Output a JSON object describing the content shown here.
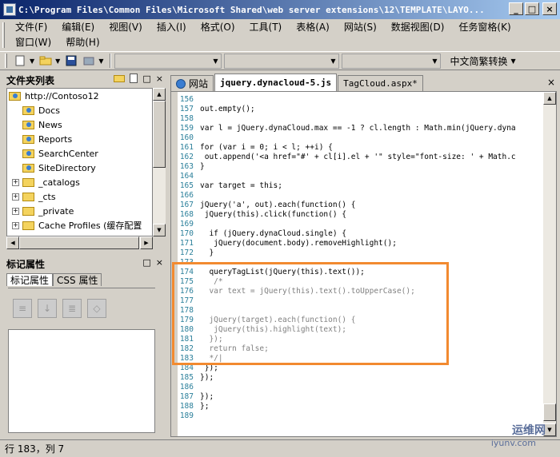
{
  "window": {
    "title": "C:\\Program Files\\Common Files\\Microsoft Shared\\web server extensions\\12\\TEMPLATE\\LAYO..."
  },
  "menu": {
    "row1": [
      "文件(F)",
      "编辑(E)",
      "视图(V)",
      "插入(I)",
      "格式(O)",
      "工具(T)",
      "表格(A)",
      "网站(S)",
      "数据视图(D)",
      "任务窗格(K)"
    ],
    "row2": [
      "窗口(W)",
      "帮助(H)"
    ]
  },
  "toolbar": {
    "convert_label": "中文简繁转换"
  },
  "folder_list": {
    "title": "文件夹列表",
    "items": [
      {
        "label": "http://Contoso12",
        "kind": "web",
        "expander": ""
      },
      {
        "label": "Docs",
        "kind": "web",
        "expander": ""
      },
      {
        "label": "News",
        "kind": "web",
        "expander": ""
      },
      {
        "label": "Reports",
        "kind": "web",
        "expander": ""
      },
      {
        "label": "SearchCenter",
        "kind": "web",
        "expander": ""
      },
      {
        "label": "SiteDirectory",
        "kind": "web",
        "expander": ""
      },
      {
        "label": "_catalogs",
        "kind": "folder",
        "expander": "+"
      },
      {
        "label": "_cts",
        "kind": "folder",
        "expander": "+"
      },
      {
        "label": "_private",
        "kind": "folder",
        "expander": "+"
      },
      {
        "label": "Cache Profiles (缓存配置",
        "kind": "list",
        "expander": "+"
      }
    ]
  },
  "tag_properties": {
    "title": "标记属性",
    "tabs": [
      "标记属性",
      "CSS 属性"
    ]
  },
  "editor": {
    "tabs": [
      {
        "label": "网站"
      },
      {
        "label": "jquery.dynacloud-5.js"
      },
      {
        "label": "TagCloud.aspx*"
      }
    ],
    "lines": [
      {
        "n": "156",
        "text": "",
        "style": ""
      },
      {
        "n": "157",
        "text": "out.empty();",
        "style": ""
      },
      {
        "n": "158",
        "text": "",
        "style": ""
      },
      {
        "n": "159",
        "text": "var l = jQuery.dynaCloud.max == -1 ? cl.length : Math.min(jQuery.dyna",
        "style": ""
      },
      {
        "n": "160",
        "text": "",
        "style": ""
      },
      {
        "n": "161",
        "text": "for (var i = 0; i < l; ++i) {",
        "style": ""
      },
      {
        "n": "162",
        "text": " out.append('<a href=\"#' + cl[i].el + '\" style=\"font-size: ' + Math.c",
        "style": ""
      },
      {
        "n": "163",
        "text": "}",
        "style": ""
      },
      {
        "n": "164",
        "text": "",
        "style": ""
      },
      {
        "n": "165",
        "text": "var target = this;",
        "style": ""
      },
      {
        "n": "166",
        "text": "",
        "style": ""
      },
      {
        "n": "167",
        "text": "jQuery('a', out).each(function() {",
        "style": ""
      },
      {
        "n": "168",
        "text": " jQuery(this).click(function() {",
        "style": ""
      },
      {
        "n": "169",
        "text": "",
        "style": ""
      },
      {
        "n": "170",
        "text": "  if (jQuery.dynaCloud.single) {",
        "style": ""
      },
      {
        "n": "171",
        "text": "   jQuery(document.body).removeHighlight();",
        "style": ""
      },
      {
        "n": "172",
        "text": "  }",
        "style": ""
      },
      {
        "n": "173",
        "text": "",
        "style": ""
      },
      {
        "n": "174",
        "text": "  queryTagList(jQuery(this).text());",
        "style": ""
      },
      {
        "n": "175",
        "text": "   /*",
        "style": "comment"
      },
      {
        "n": "176",
        "text": "  var text = jQuery(this).text().toUpperCase();",
        "style": "comment"
      },
      {
        "n": "177",
        "text": "",
        "style": "comment"
      },
      {
        "n": "178",
        "text": "",
        "style": "comment"
      },
      {
        "n": "179",
        "text": "  jQuery(target).each(function() {",
        "style": "comment"
      },
      {
        "n": "180",
        "text": "   jQuery(this).highlight(text);",
        "style": "comment"
      },
      {
        "n": "181",
        "text": "  });",
        "style": "comment"
      },
      {
        "n": "182",
        "text": "  return false;",
        "style": "comment"
      },
      {
        "n": "183",
        "text": "  */|",
        "style": "comment"
      },
      {
        "n": "184",
        "text": " });",
        "style": ""
      },
      {
        "n": "185",
        "text": "});",
        "style": ""
      },
      {
        "n": "186",
        "text": "",
        "style": ""
      },
      {
        "n": "187",
        "text": "});",
        "style": ""
      },
      {
        "n": "188",
        "text": "};",
        "style": ""
      },
      {
        "n": "189",
        "text": "",
        "style": ""
      }
    ]
  },
  "status": {
    "position": "行 183，列 7"
  },
  "watermark": {
    "line1": "运维网",
    "line2": "iyunv.com"
  },
  "colors": {
    "highlight_border": "#f28a30",
    "line_number": "#2a7f9a",
    "comment": "#808080"
  }
}
